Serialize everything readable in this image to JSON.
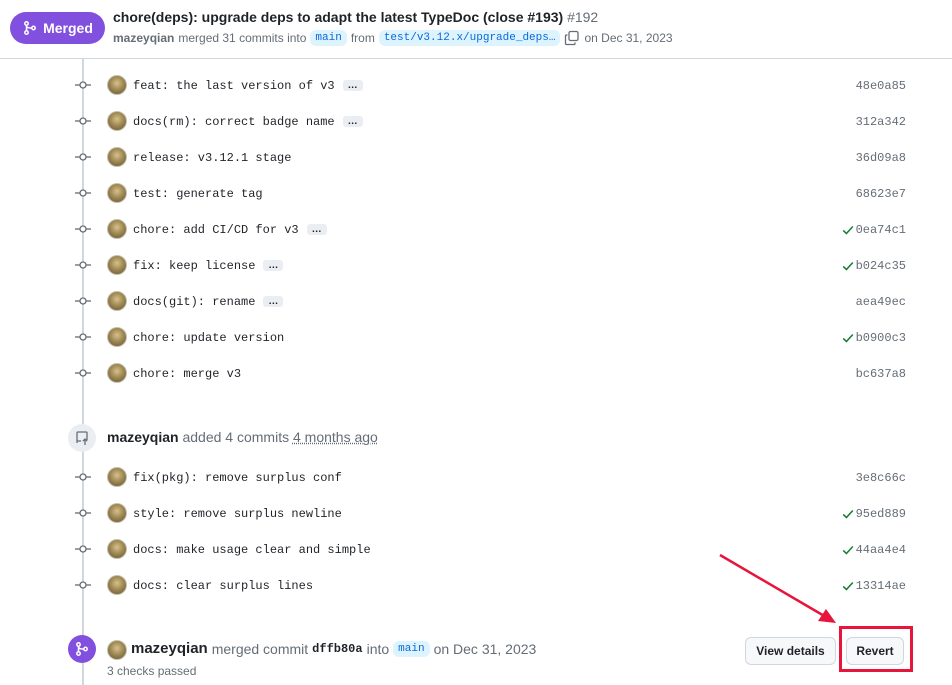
{
  "header": {
    "status_label": "Merged",
    "title": "chore(deps): upgrade deps to adapt the latest TypeDoc (close #193)",
    "number": "#192",
    "author": "mazeyqian",
    "merged_text": "merged 31 commits into",
    "base_branch": "main",
    "from_text": "from",
    "head_branch": "test/v3.12.x/upgrade_deps…",
    "date_text": "on Dec 31, 2023"
  },
  "commits_group_1": [
    {
      "message": "feat: the last version of v3",
      "has_more": true,
      "check": false,
      "sha": "48e0a85"
    },
    {
      "message": "docs(rm): correct badge name",
      "has_more": true,
      "check": false,
      "sha": "312a342"
    },
    {
      "message": "release: v3.12.1 stage",
      "has_more": false,
      "check": false,
      "sha": "36d09a8"
    },
    {
      "message": "test: generate tag",
      "has_more": false,
      "check": false,
      "sha": "68623e7"
    },
    {
      "message": "chore: add CI/CD for v3",
      "has_more": true,
      "check": true,
      "sha": "0ea74c1"
    },
    {
      "message": "fix: keep license",
      "has_more": true,
      "check": true,
      "sha": "b024c35"
    },
    {
      "message": "docs(git): rename",
      "has_more": true,
      "check": false,
      "sha": "aea49ec"
    },
    {
      "message": "chore: update version",
      "has_more": false,
      "check": true,
      "sha": "b0900c3"
    },
    {
      "message": "chore: merge v3",
      "has_more": false,
      "check": false,
      "sha": "bc637a8"
    }
  ],
  "added_event": {
    "user": "mazeyqian",
    "text": "added 4 commits",
    "time": "4 months ago"
  },
  "commits_group_2": [
    {
      "message": "fix(pkg): remove surplus conf",
      "has_more": false,
      "check": false,
      "sha": "3e8c66c"
    },
    {
      "message": "style: remove surplus newline",
      "has_more": false,
      "check": true,
      "sha": "95ed889"
    },
    {
      "message": "docs: make usage clear and simple",
      "has_more": false,
      "check": true,
      "sha": "44aa4e4"
    },
    {
      "message": "docs: clear surplus lines",
      "has_more": false,
      "check": true,
      "sha": "13314ae"
    }
  ],
  "merge_event": {
    "user": "mazeyqian",
    "text": "merged commit",
    "sha": "dffb80a",
    "into_text": "into",
    "branch": "main",
    "date_text": "on Dec 31, 2023",
    "checks": "3 checks passed",
    "view_details_label": "View details",
    "revert_label": "Revert"
  },
  "ellipsis_label": "…",
  "colors": {
    "merged_purple": "#8250df",
    "check_green": "#1a7f37",
    "highlight_red": "#e8143c",
    "branch_bg": "#ddf4ff",
    "branch_fg": "#0969da"
  }
}
